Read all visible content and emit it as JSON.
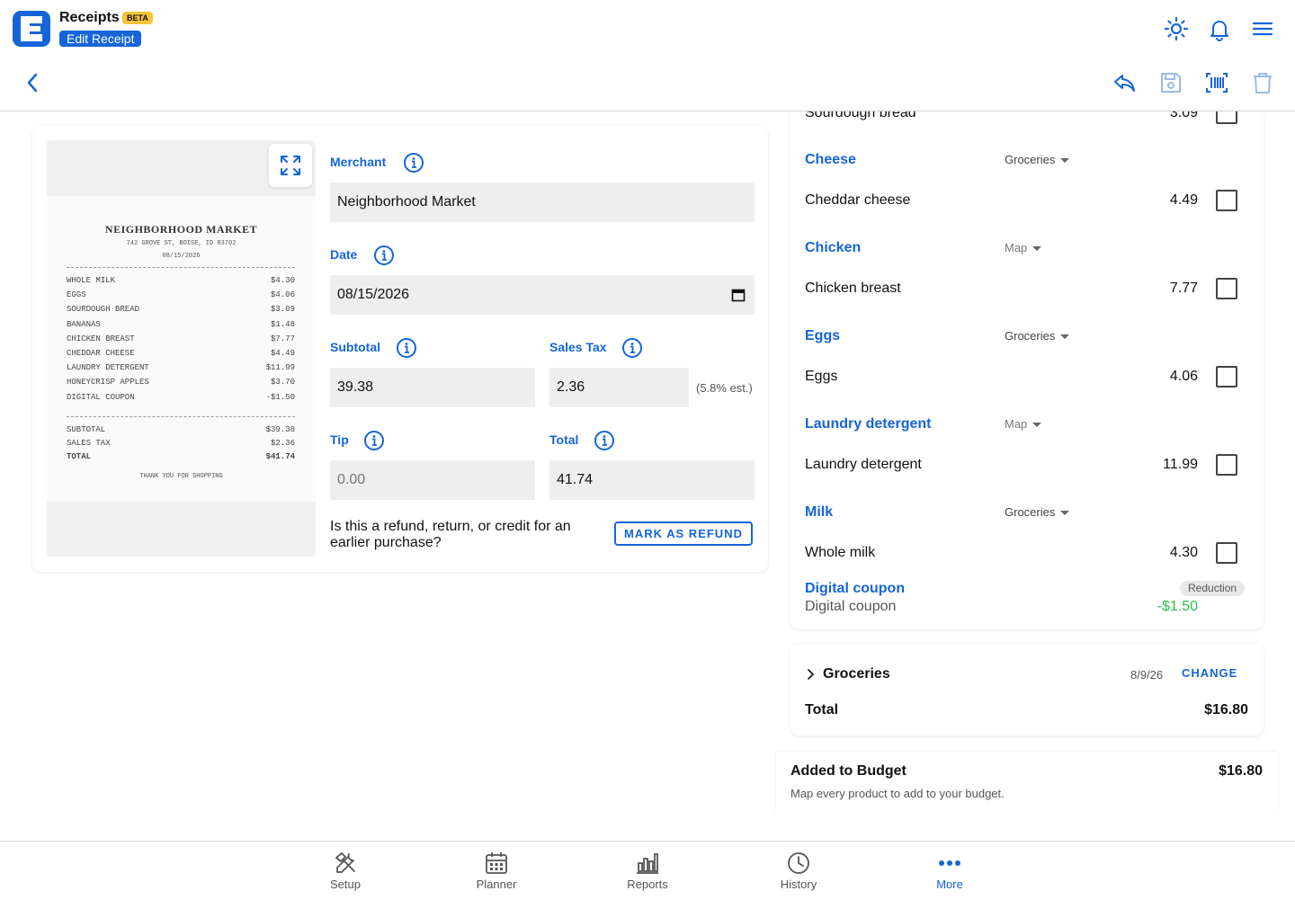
{
  "app": {
    "title": "Receipts",
    "badge": "BETA",
    "page_label": "Edit Receipt",
    "logo_letter": "E"
  },
  "colors": {
    "accent": "#1565d8",
    "beta_badge": "#f6c43a",
    "reduction_green": "#2fbf4a"
  },
  "icons": {
    "header": [
      "sun-icon",
      "bell-icon",
      "menu-icon"
    ],
    "toolbar": [
      "back-chevron-icon",
      "reply-icon",
      "save-icon",
      "barcode-icon",
      "trash-icon"
    ]
  },
  "receipt_image": {
    "store": "NEIGHBORHOOD MARKET",
    "address": "742 GROVE ST, BOISE, ID 83702",
    "date": "08/15/2026",
    "lines": [
      {
        "name": "WHOLE MILK",
        "amount": "$4.30"
      },
      {
        "name": "EGGS",
        "amount": "$4.06"
      },
      {
        "name": "SOURDOUGH BREAD",
        "amount": "$3.09"
      },
      {
        "name": "BANANAS",
        "amount": "$1.48"
      },
      {
        "name": "CHICKEN BREAST",
        "amount": "$7.77"
      },
      {
        "name": "CHEDDAR CHEESE",
        "amount": "$4.49"
      },
      {
        "name": "LAUNDRY DETERGENT",
        "amount": "$11.99"
      },
      {
        "name": "HONEYCRISP APPLES",
        "amount": "$3.70"
      },
      {
        "name": "DIGITAL COUPON",
        "amount": "-$1.50"
      }
    ],
    "totals": [
      {
        "name": "SUBTOTAL",
        "amount": "$39.38"
      },
      {
        "name": "SALES TAX",
        "amount": "$2.36"
      },
      {
        "name": "TOTAL",
        "amount": "$41.74"
      }
    ],
    "footer": "THANK YOU FOR SHOPPING"
  },
  "form": {
    "merchant": {
      "label": "Merchant",
      "value": "Neighborhood Market"
    },
    "date": {
      "label": "Date",
      "value": "08/15/2026"
    },
    "subtotal": {
      "label": "Subtotal",
      "value": "39.38"
    },
    "sales_tax": {
      "label": "Sales Tax",
      "value": "2.36",
      "hint": "(5.8% est.)"
    },
    "tip": {
      "label": "Tip",
      "value": "0.00"
    },
    "total": {
      "label": "Total",
      "value": "41.74"
    },
    "refund_question": "Is this a refund, return, or credit for an earlier purchase?",
    "refund_button": "MARK AS REFUND"
  },
  "items": {
    "partial_top": {
      "name": "Sourdough bread",
      "price": "3.09"
    },
    "groups": [
      {
        "category": "Cheese",
        "budget": "Groceries",
        "mapped": true,
        "item": "Cheddar cheese",
        "price": "4.49"
      },
      {
        "category": "Chicken",
        "budget": "Map",
        "mapped": false,
        "item": "Chicken breast",
        "price": "7.77"
      },
      {
        "category": "Eggs",
        "budget": "Groceries",
        "mapped": true,
        "item": "Eggs",
        "price": "4.06"
      },
      {
        "category": "Laundry detergent",
        "budget": "Map",
        "mapped": false,
        "item": "Laundry detergent",
        "price": "11.99"
      },
      {
        "category": "Milk",
        "budget": "Groceries",
        "mapped": true,
        "item": "Whole milk",
        "price": "4.30"
      }
    ],
    "reduction": {
      "category": "Digital coupon",
      "item": "Digital coupon",
      "badge": "Reduction",
      "amount": "-$1.50"
    }
  },
  "summary": {
    "group_name": "Groceries",
    "date": "8/9/26",
    "change_label": "CHANGE",
    "total_label": "Total",
    "total_value": "$16.80"
  },
  "budget": {
    "title": "Added to Budget",
    "amount": "$16.80",
    "note": "Map every product to add to your budget."
  },
  "nav": [
    {
      "label": "Setup",
      "icon": "tools-icon",
      "active": false
    },
    {
      "label": "Planner",
      "icon": "calendar-icon",
      "active": false
    },
    {
      "label": "Reports",
      "icon": "bar-chart-icon",
      "active": false
    },
    {
      "label": "History",
      "icon": "clock-icon",
      "active": false
    },
    {
      "label": "More",
      "icon": "more-dots-icon",
      "active": true
    }
  ]
}
